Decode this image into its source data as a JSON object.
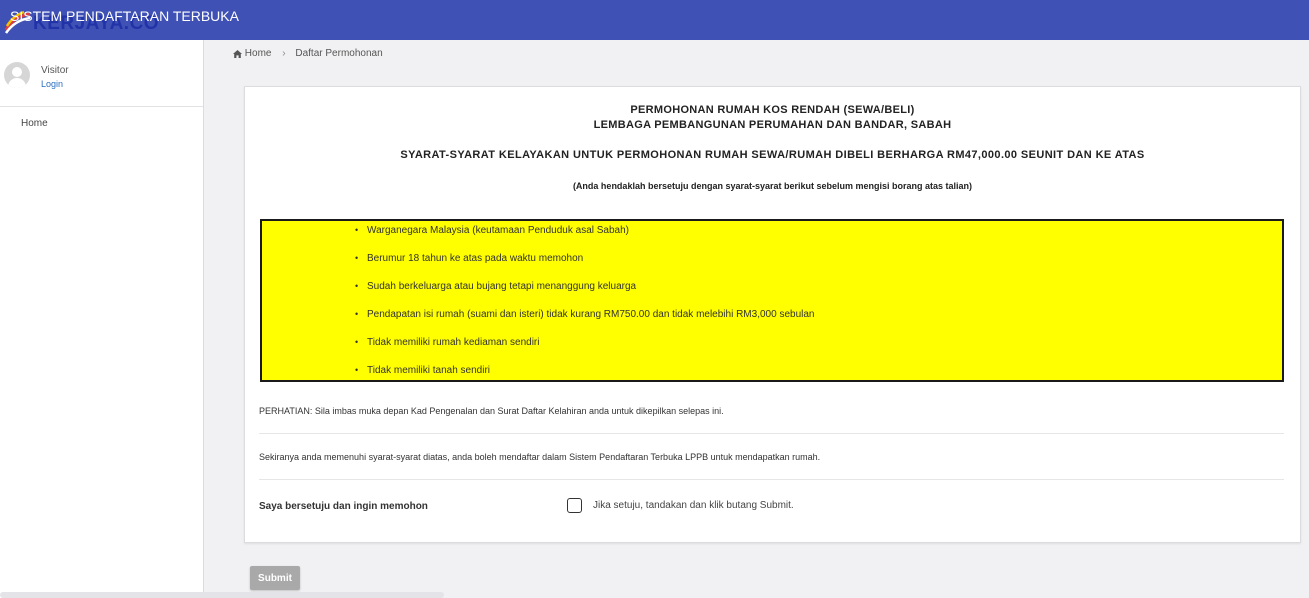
{
  "header": {
    "app_title": "SISTEM PENDAFTARAN TERBUKA",
    "logo_text": "KERJAYA.CO",
    "color": "#3f51b5"
  },
  "sidebar": {
    "user_name": "Visitor",
    "login_label": "Login",
    "items": [
      {
        "label": "Home"
      }
    ]
  },
  "breadcrumb": {
    "home": "Home",
    "current": "Daftar Permohonan"
  },
  "form": {
    "title_line1": "PERMOHONAN RUMAH KOS RENDAH (SEWA/BELI)",
    "title_line2": "LEMBAGA PEMBANGUNAN PERUMAHAN DAN BANDAR, SABAH",
    "subtitle": "SYARAT-SYARAT KELAYAKAN UNTUK PERMOHONAN RUMAH SEWA/RUMAH DIBELI BERHARGA RM47,000.00 SEUNIT DAN KE ATAS",
    "note": "(Anda hendaklah bersetuju dengan syarat-syarat berikut sebelum mengisi borang atas talian)",
    "highlight_color": "#ffff00",
    "requirements": [
      "Warganegara Malaysia (keutamaan Penduduk asal Sabah)",
      "Berumur 18 tahun ke atas pada waktu memohon",
      "Sudah berkeluarga atau bujang tetapi menanggung keluarga",
      "Pendapatan isi rumah (suami dan isteri) tidak kurang RM750.00 dan tidak melebihi RM3,000 sebulan",
      "Tidak memiliki rumah kediaman sendiri",
      "Tidak memiliki tanah sendiri"
    ],
    "attention": "PERHATIAN: Sila imbas muka depan Kad Pengenalan dan Surat Daftar Kelahiran anda untuk dikepilkan selepas ini.",
    "eligibility_text": "Sekiranya anda memenuhi syarat-syarat diatas, anda boleh mendaftar dalam Sistem Pendaftaran Terbuka LPPB untuk mendapatkan rumah.",
    "agree_label": "Saya bersetuju dan ingin memohon",
    "agree_checked": false,
    "agree_hint": "Jika setuju, tandakan dan klik butang Submit.",
    "submit_label": "Submit"
  }
}
